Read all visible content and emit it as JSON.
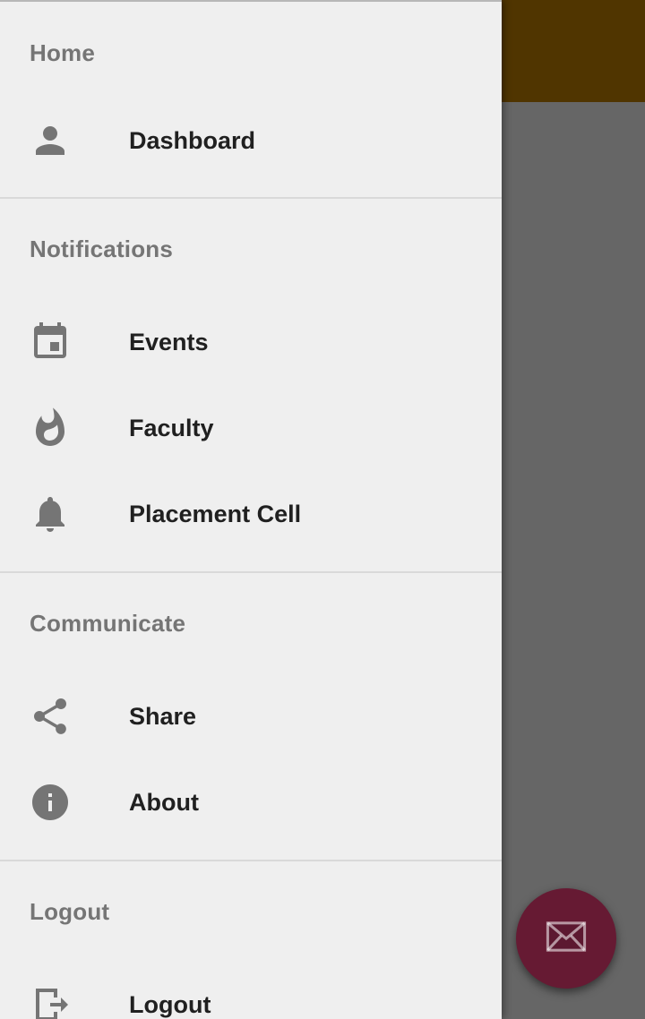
{
  "drawer": {
    "sections": [
      {
        "header": "Home",
        "items": [
          {
            "label": "Dashboard",
            "icon": "person-icon"
          }
        ]
      },
      {
        "header": "Notifications",
        "items": [
          {
            "label": "Events",
            "icon": "calendar-icon"
          },
          {
            "label": "Faculty",
            "icon": "flame-icon"
          },
          {
            "label": "Placement Cell",
            "icon": "bell-icon"
          }
        ]
      },
      {
        "header": "Communicate",
        "items": [
          {
            "label": "Share",
            "icon": "share-icon"
          },
          {
            "label": "About",
            "icon": "info-icon"
          }
        ]
      },
      {
        "header": "Logout",
        "items": [
          {
            "label": "Logout",
            "icon": "logout-icon"
          }
        ]
      }
    ]
  },
  "fab": {
    "icon": "mail-icon"
  },
  "colors": {
    "toolbar": "#c98400",
    "fab": "#661a33",
    "drawer_background": "#efefef",
    "section_header": "#757575",
    "item_text": "#202020",
    "icon": "#757575"
  }
}
